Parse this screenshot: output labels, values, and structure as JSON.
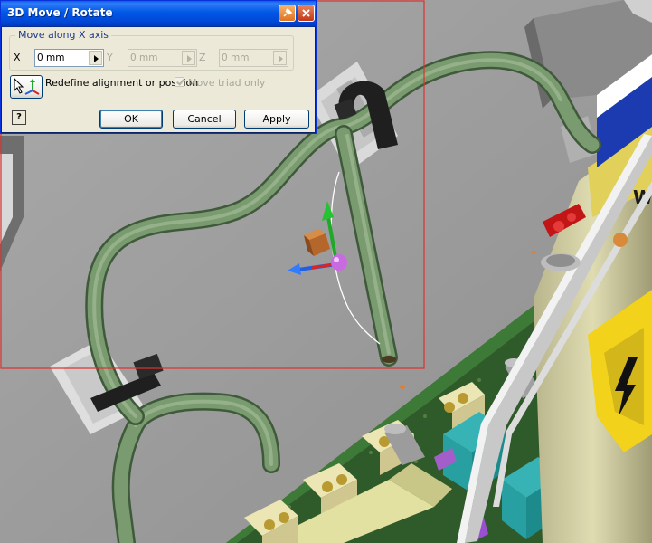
{
  "dialog": {
    "title": "3D Move / Rotate",
    "group_label": "Move along X axis",
    "axes": [
      {
        "label": "X",
        "value": "0 mm",
        "enabled": true
      },
      {
        "label": "Y",
        "value": "0 mm",
        "enabled": false
      },
      {
        "label": "Z",
        "value": "0 mm",
        "enabled": false
      }
    ],
    "redefine_label": "Redefine alignment or position",
    "move_triad_label": "Move triad only",
    "move_triad_checked": true,
    "help_label": "?",
    "ok_label": "OK",
    "cancel_label": "Cancel",
    "apply_label": "Apply"
  },
  "viewport": {
    "warning_sticker_text": "W"
  },
  "colors": {
    "titlebar": "#0054e3",
    "dialog_face": "#ece9d8",
    "selection_box": "#e03030",
    "tube": "#6c8a62",
    "background": "#9a9a9a",
    "pcb": "#2f5a2a"
  },
  "icons": {
    "pin": "pin-icon",
    "close": "close-icon",
    "redefine": "triad-cursor-icon",
    "help": "help-icon"
  }
}
